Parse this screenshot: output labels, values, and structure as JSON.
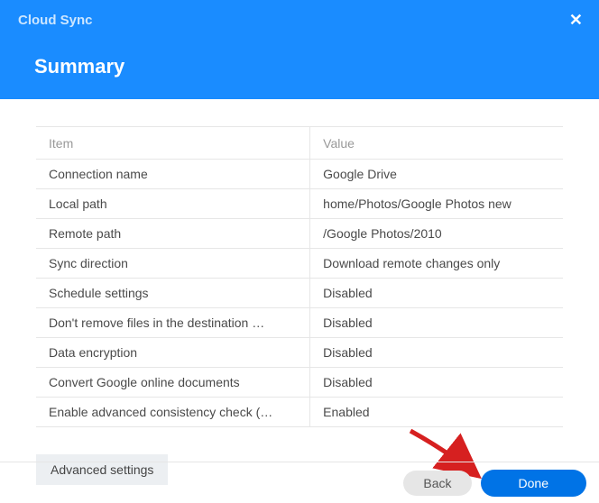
{
  "header": {
    "app_title": "Cloud Sync",
    "page_heading": "Summary"
  },
  "table": {
    "headers": {
      "item": "Item",
      "value": "Value"
    },
    "rows": [
      {
        "item": "Connection name",
        "value": "Google Drive"
      },
      {
        "item": "Local path",
        "value": "home/Photos/Google Photos new"
      },
      {
        "item": "Remote path",
        "value": "/Google Photos/2010"
      },
      {
        "item": "Sync direction",
        "value": "Download remote changes only"
      },
      {
        "item": "Schedule settings",
        "value": "Disabled"
      },
      {
        "item": "Don't remove files in the destination …",
        "value": "Disabled"
      },
      {
        "item": "Data encryption",
        "value": "Disabled"
      },
      {
        "item": "Convert Google online documents",
        "value": "Disabled"
      },
      {
        "item": "Enable advanced consistency check (…",
        "value": "Enabled"
      }
    ]
  },
  "buttons": {
    "advanced": "Advanced settings",
    "back": "Back",
    "done": "Done"
  }
}
